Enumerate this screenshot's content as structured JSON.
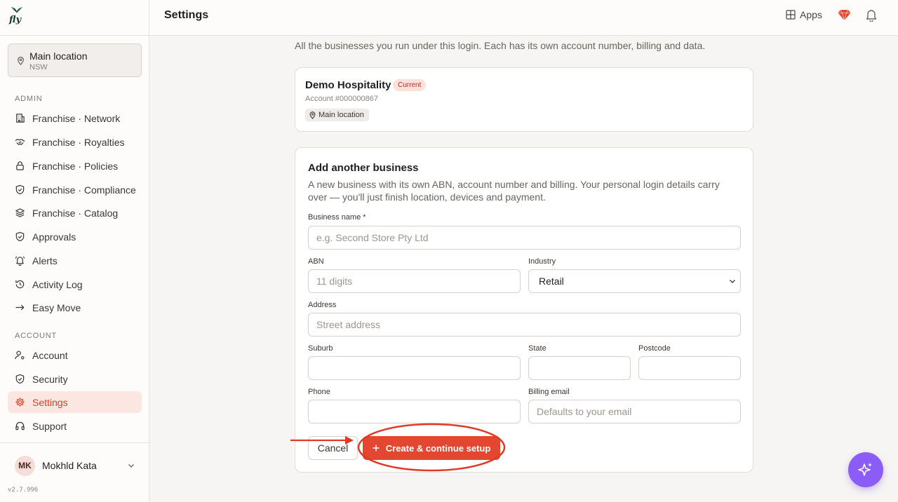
{
  "topbar": {
    "title": "Settings",
    "apps_label": "Apps"
  },
  "sidebar": {
    "location": {
      "name": "Main location",
      "region": "NSW"
    },
    "admin_heading": "ADMIN",
    "admin_items": [
      {
        "label": "Franchise · Network",
        "icon": "building-icon"
      },
      {
        "label": "Franchise · Royalties",
        "icon": "handshake-icon"
      },
      {
        "label": "Franchise · Policies",
        "icon": "lock-icon"
      },
      {
        "label": "Franchise · Compliance",
        "icon": "shield-check-icon"
      },
      {
        "label": "Franchise · Catalog",
        "icon": "layers-icon"
      },
      {
        "label": "Approvals",
        "icon": "shield-check-icon"
      },
      {
        "label": "Alerts",
        "icon": "bell-ring-icon"
      },
      {
        "label": "Activity Log",
        "icon": "history-icon"
      },
      {
        "label": "Easy Move",
        "icon": "arrow-right-icon"
      }
    ],
    "account_heading": "ACCOUNT",
    "account_items": [
      {
        "label": "Account",
        "icon": "user-cog-icon"
      },
      {
        "label": "Security",
        "icon": "shield-icon"
      },
      {
        "label": "Settings",
        "icon": "gear-icon",
        "active": true
      },
      {
        "label": "Support",
        "icon": "headphones-icon"
      }
    ],
    "user": {
      "initials": "MK",
      "name": "Mokhld Kata"
    },
    "version": "v2.7.996"
  },
  "main": {
    "description": "All the businesses you run under this login. Each has its own account number, billing and data.",
    "current_business": {
      "name": "Demo Hospitality",
      "badge": "Current",
      "account": "Account #000000867",
      "location": "Main location"
    },
    "form": {
      "title": "Add another business",
      "description": "A new business with its own ABN, account number and billing. Your personal login details carry over — you'll just finish location, devices and payment.",
      "business_name": {
        "label": "Business name *",
        "placeholder": "e.g. Second Store Pty Ltd",
        "value": ""
      },
      "abn": {
        "label": "ABN",
        "placeholder": "11 digits",
        "value": ""
      },
      "industry": {
        "label": "Industry",
        "value": "Retail"
      },
      "address": {
        "label": "Address",
        "placeholder": "Street address",
        "value": ""
      },
      "suburb": {
        "label": "Suburb",
        "value": ""
      },
      "state": {
        "label": "State",
        "value": ""
      },
      "postcode": {
        "label": "Postcode",
        "value": ""
      },
      "phone": {
        "label": "Phone",
        "value": ""
      },
      "billing_email": {
        "label": "Billing email",
        "placeholder": "Defaults to your email",
        "value": ""
      },
      "cancel_label": "Cancel",
      "submit_label": "Create & continue setup"
    }
  },
  "colors": {
    "accent": "#e4472f",
    "active_bg": "#fbe6e1",
    "annotation": "#e03a26",
    "fab": "#8b5cf6"
  }
}
